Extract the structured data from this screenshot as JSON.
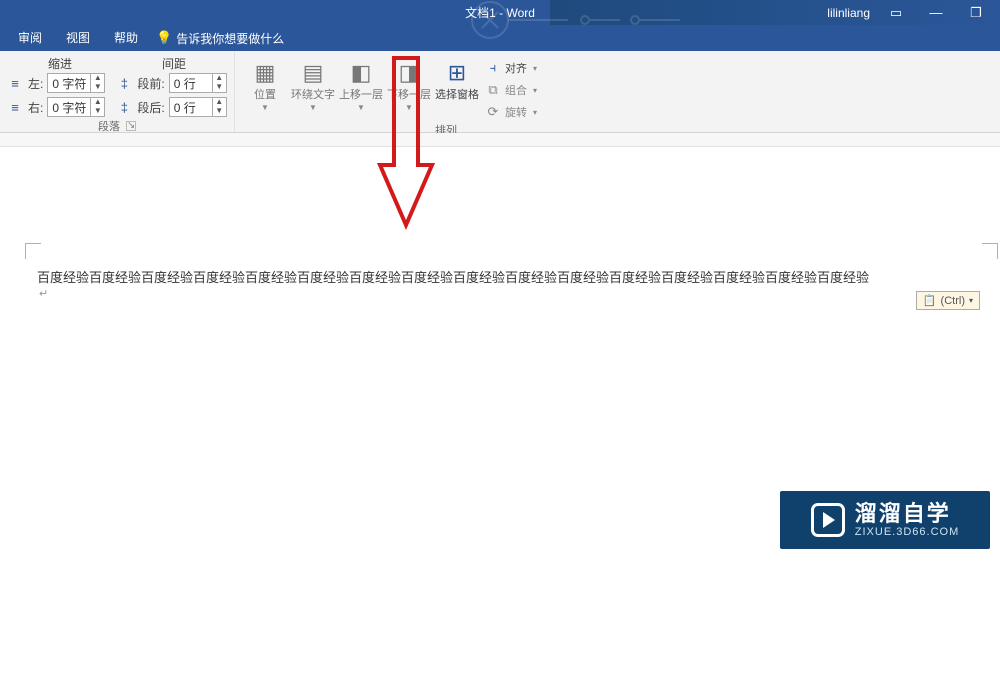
{
  "title": {
    "doc": "文档1",
    "app": "Word"
  },
  "user": {
    "name": "lilinliang"
  },
  "tabs": {
    "review": "审阅",
    "view": "视图",
    "help": "帮助"
  },
  "tell_me": "告诉我你想要做什么",
  "ribbon": {
    "paragraph": {
      "indent_header": "缩进",
      "spacing_header": "间距",
      "left_label": "左:",
      "right_label": "右:",
      "before_label": "段前:",
      "after_label": "段后:",
      "left_value": "0 字符",
      "right_value": "0 字符",
      "before_value": "0 行",
      "after_value": "0 行",
      "group_label": "段落"
    },
    "arrange": {
      "position": "位置",
      "wrap": "环绕文字",
      "forward": "上移一层",
      "backward": "下移一层",
      "selection_pane": "选择窗格",
      "align": "对齐",
      "group": "组合",
      "rotate": "旋转",
      "group_label": "排列"
    }
  },
  "document": {
    "text": "百度经验百度经验百度经验百度经验百度经验百度经验百度经验百度经验百度经验百度经验百度经验百度经验百度经验百度经验百度经验百度经验",
    "paste_options": "(Ctrl)"
  },
  "watermark": {
    "cn": "溜溜自学",
    "en": "ZIXUE.3D66.COM"
  }
}
